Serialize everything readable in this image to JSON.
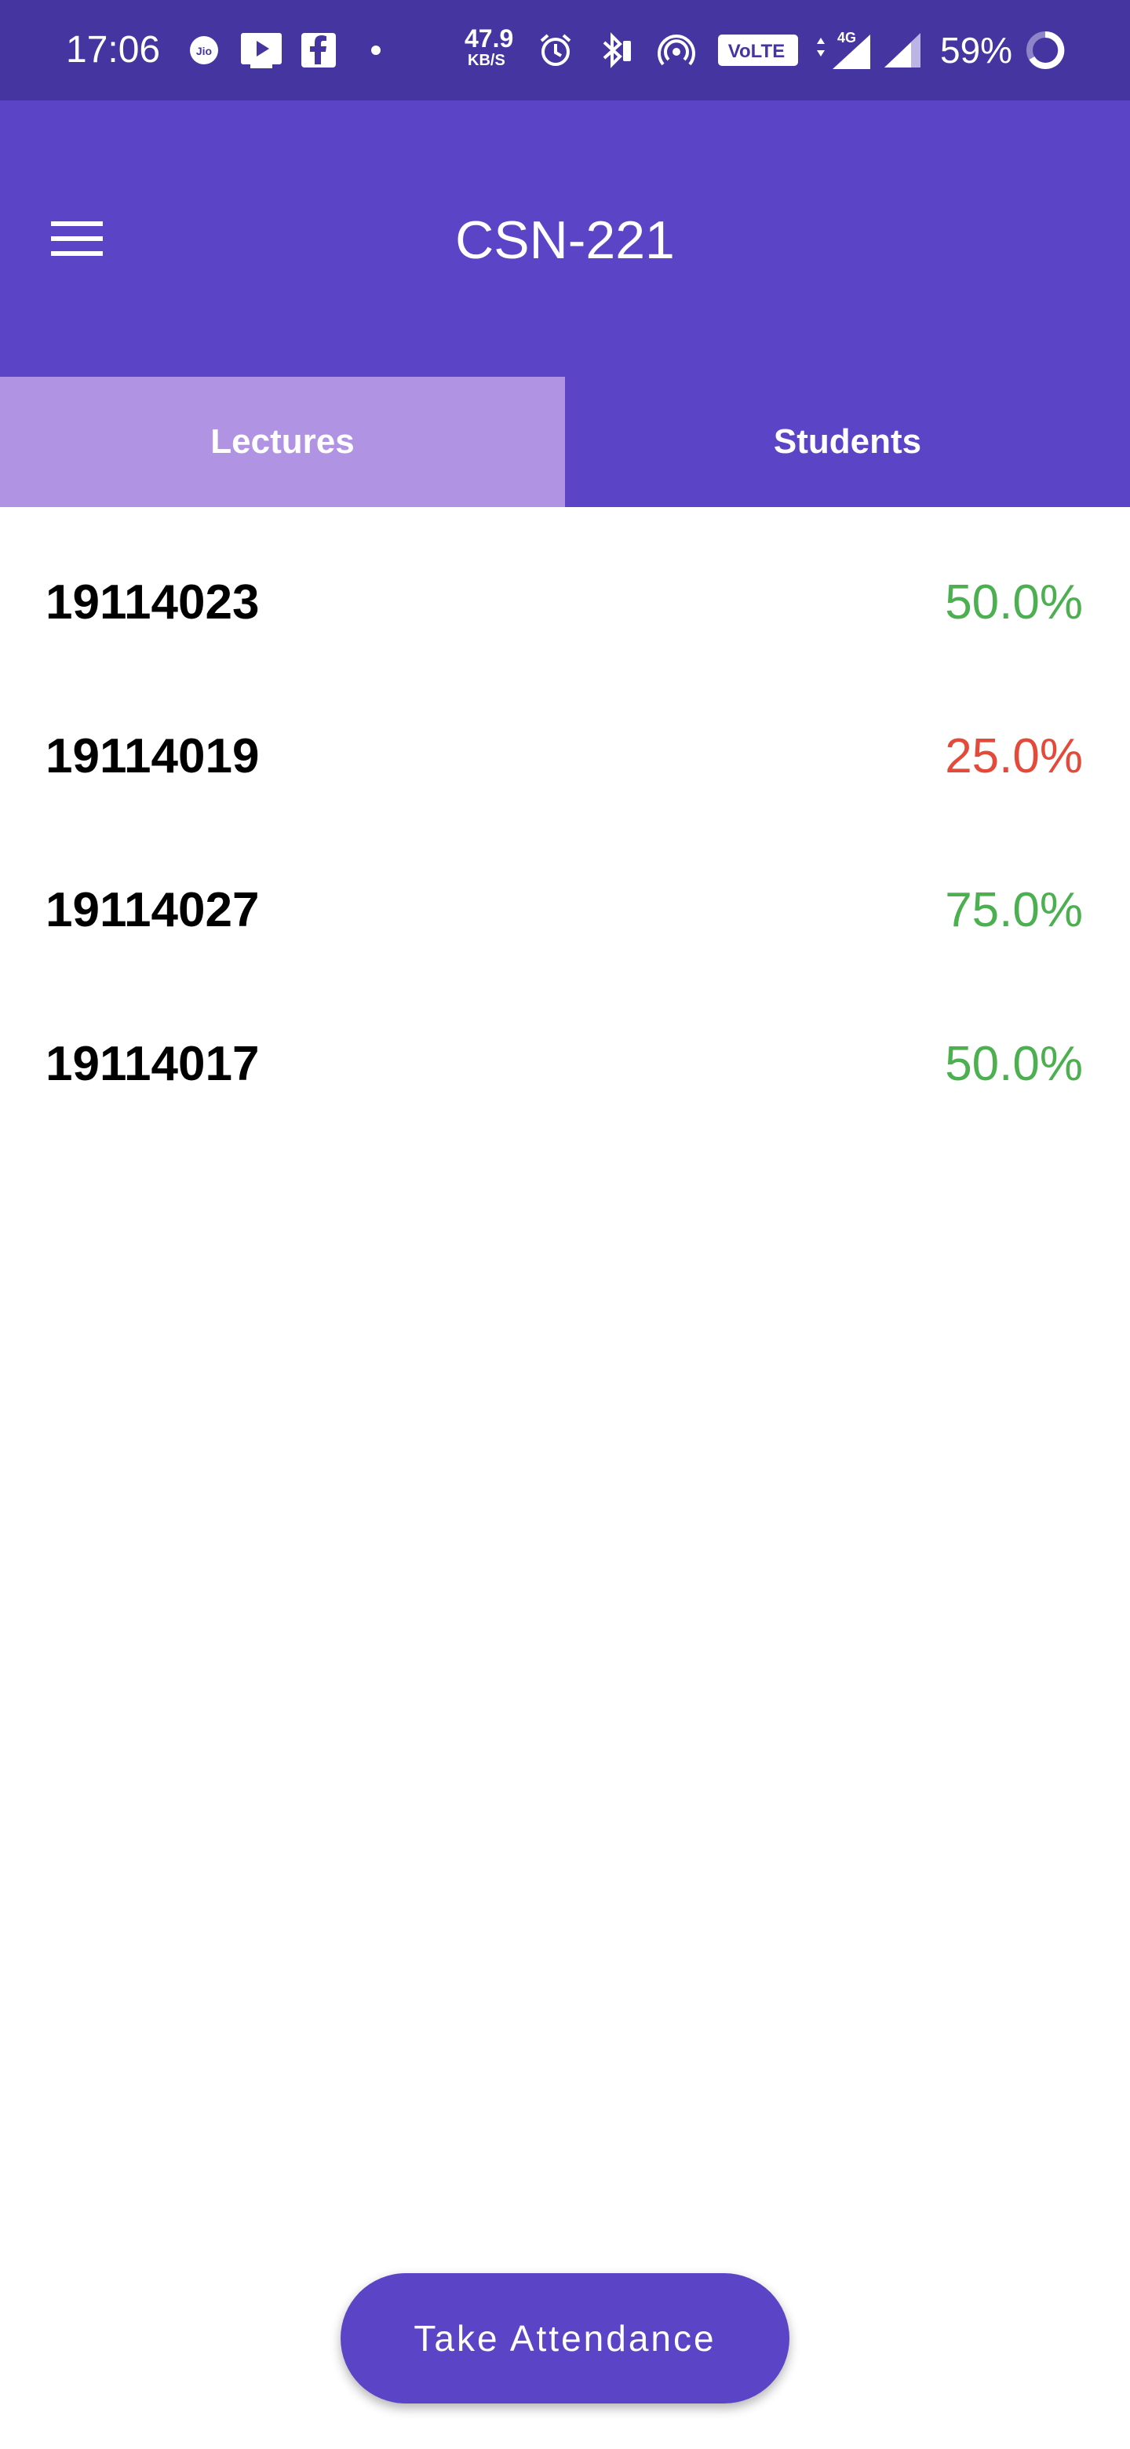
{
  "status_bar": {
    "time": "17:06",
    "net_speed_value": "47.9",
    "net_speed_unit": "KB/S",
    "volte_label": "VoLTE",
    "network_type": "4G",
    "battery": "59%",
    "icons": [
      "jio-icon",
      "youtube-icon",
      "facebook-icon",
      "dot-icon",
      "alarm-icon",
      "bluetooth-icon",
      "hotspot-icon",
      "volte-icon",
      "signal-4g-icon",
      "signal-icon",
      "battery-icon"
    ]
  },
  "app_bar": {
    "title": "CSN-221",
    "menu_icon": "menu-icon"
  },
  "tabs": [
    {
      "label": "Lectures",
      "color": "#b193e4"
    },
    {
      "label": "Students",
      "color": "#5b45c6"
    }
  ],
  "students": [
    {
      "id": "19114023",
      "percent": "50.0%",
      "color": "#4caf50"
    },
    {
      "id": "19114019",
      "percent": "25.0%",
      "color": "#e44a3a"
    },
    {
      "id": "19114027",
      "percent": "75.0%",
      "color": "#4caf50"
    },
    {
      "id": "19114017",
      "percent": "50.0%",
      "color": "#4caf50"
    }
  ],
  "action_button": {
    "label": "Take Attendance"
  },
  "colors": {
    "status_bar": "#4535a0",
    "primary": "#5b45c6",
    "tab_selected": "#b193e4",
    "good": "#4caf50",
    "bad": "#e44a3a"
  }
}
